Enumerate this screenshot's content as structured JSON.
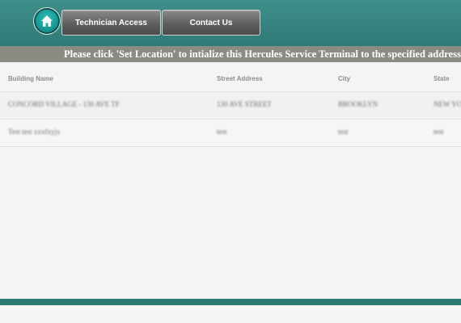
{
  "nav": {
    "home_icon": "home-icon",
    "technician_label": "Technician Access",
    "contact_label": "Contact Us"
  },
  "notice": {
    "text": "Please click 'Set Location' to intialize this Hercules Service Terminal to the specified address."
  },
  "table": {
    "headers": [
      "Building Name",
      "Street Address",
      "City",
      "State"
    ],
    "rows": [
      [
        "CONCORD VILLAGE - 130 AVE TF",
        "130 AVE STREET",
        "BROOKLYN",
        "NEW YORK"
      ],
      [
        "Test test xxxfxyjx",
        "test",
        "test",
        "test"
      ]
    ]
  },
  "colors": {
    "header_teal": "#3f8f8a",
    "notice_gray": "#8b8b83",
    "button_gray": "#5f5f5f"
  }
}
